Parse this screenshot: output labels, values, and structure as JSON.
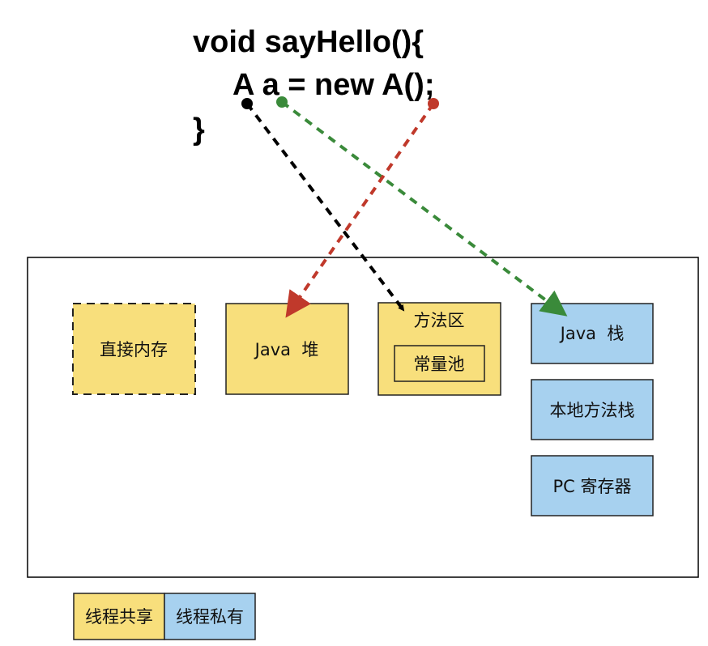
{
  "code": {
    "line1": "void sayHello(){",
    "line2": "A a = new A();",
    "line3": "}"
  },
  "memory": {
    "direct_memory": "直接内存",
    "java_heap": "Java  堆",
    "method_area": "方法区",
    "constant_pool": "常量池",
    "java_stack": "Java  栈",
    "native_method_stack": "本地方法栈",
    "pc_register": "PC 寄存器"
  },
  "legend": {
    "shared": "线程共享",
    "private": "线程私有"
  },
  "colors": {
    "shared": "#F8DF7C",
    "private": "#A7D1EF",
    "arrow_type": "#000000",
    "arrow_variable": "#3A8A3A",
    "arrow_instance": "#C0392B"
  }
}
